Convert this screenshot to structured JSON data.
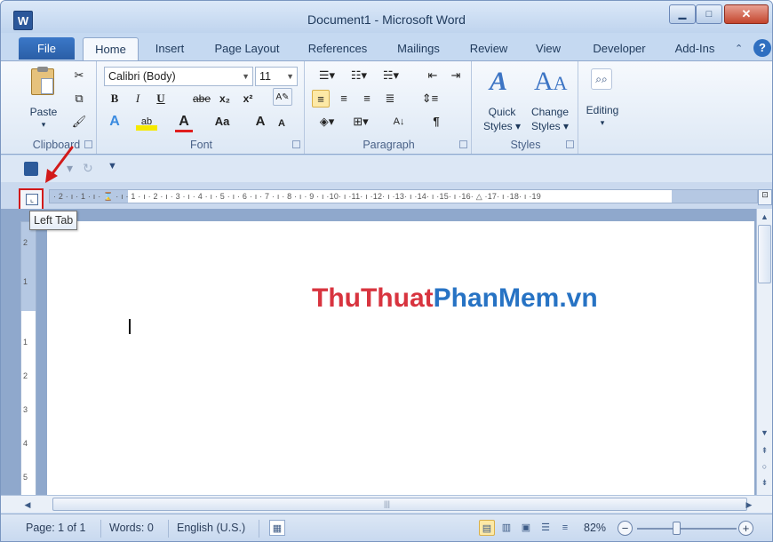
{
  "window": {
    "title": "Document1  -  Microsoft Word",
    "app_icon_letter": "W",
    "minimize_glyph": "▁",
    "maximize_glyph": "□",
    "close_glyph": "✕"
  },
  "tabs": {
    "file": "File",
    "items": [
      "Home",
      "Insert",
      "Page Layout",
      "References",
      "Mailings",
      "Review",
      "View",
      "Developer",
      "Add-Ins"
    ],
    "active": "Home",
    "help_glyph": "?",
    "minimize_ribbon_glyph": "⌃"
  },
  "ribbon": {
    "clipboard": {
      "label": "Clipboard",
      "paste_label": "Paste",
      "paste_arrow": "▾"
    },
    "font": {
      "label": "Font",
      "font_name": "Calibri (Body)",
      "font_size": "11",
      "bold": "B",
      "italic": "I",
      "underline": "U",
      "strikethrough": "abe",
      "subscript": "x₂",
      "superscript": "x²",
      "change_case": "Aa",
      "grow": "A",
      "shrink": "A"
    },
    "paragraph": {
      "label": "Paragraph",
      "pilcrow": "¶",
      "sort": "A↓"
    },
    "styles": {
      "label": "Styles",
      "quick_styles_line1": "Quick",
      "quick_styles_line2": "Styles ▾",
      "change_styles_line1": "Change",
      "change_styles_line2": "Styles ▾"
    },
    "editing": {
      "label": "Editing",
      "arrow": "▾"
    }
  },
  "ruler": {
    "tab_selector_tooltip": "Left Tab",
    "tab_selector_glyph": "⌞",
    "horizontal_marks": "· 2 · ı · 1 · ı · ⌛ · ı · 1 · ı · 2 · ı · 3 · ı · 4 · ı · 5 · ı · 6 · ı · 7 · ı · 8 · ı · 9 · ı ·10· ı ·11· ı ·12· ı ·13· ı ·14· ı ·15· ı ·16· △ ·17· ı ·18· ı ·19",
    "vertical_marks": [
      "2",
      "1",
      "1",
      "2",
      "3",
      "4",
      "5"
    ]
  },
  "document": {
    "watermark_part1": "ThuThuat",
    "watermark_part2": "PhanMem.vn",
    "colors": {
      "watermark_red": "#d8343f",
      "watermark_blue": "#2773c4",
      "annotation_red": "#d21a1a"
    }
  },
  "statusbar": {
    "page": "Page: 1 of 1",
    "words": "Words: 0",
    "language": "English (U.S.)",
    "zoom": "82%",
    "zoom_minus": "−",
    "zoom_plus": "+"
  }
}
